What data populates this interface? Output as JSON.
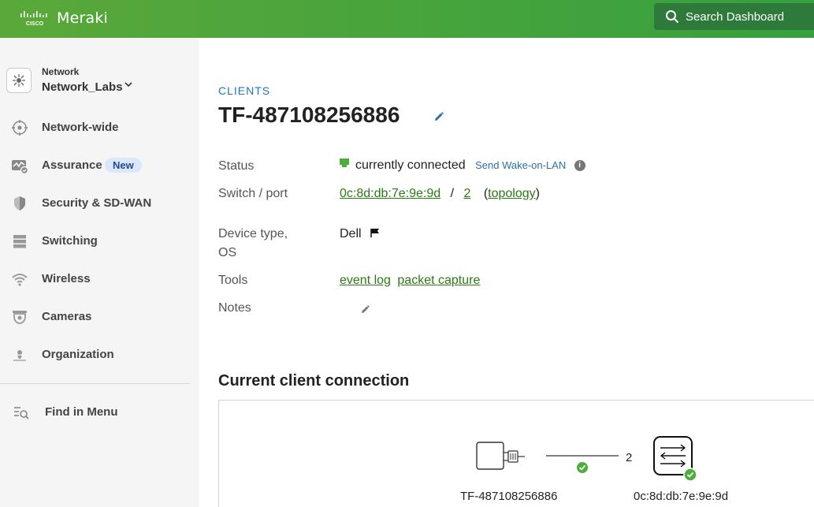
{
  "header": {
    "logo_text": "CISCO",
    "app_name": "Meraki",
    "search_label": "Search Dashboard",
    "search_icon": "search-icon",
    "brand_color": "#4caf3a"
  },
  "sidebar": {
    "network_label": "Network",
    "network_name": "Network_Labs",
    "items": [
      {
        "label": "Network-wide",
        "icon": "network-wide-icon"
      },
      {
        "label": "Assurance",
        "icon": "assurance-icon",
        "badge": "New"
      },
      {
        "label": "Security & SD-WAN",
        "icon": "shield-icon"
      },
      {
        "label": "Switching",
        "icon": "switch-icon"
      },
      {
        "label": "Wireless",
        "icon": "wifi-icon"
      },
      {
        "label": "Cameras",
        "icon": "camera-icon"
      },
      {
        "label": "Organization",
        "icon": "organization-icon"
      }
    ],
    "find_in_menu": "Find in Menu"
  },
  "main": {
    "breadcrumb": "CLIENTS",
    "title": "TF-487108256886",
    "status_label": "Status",
    "status_value": "currently connected",
    "status_color": "#4caf3a",
    "wake_on_lan": "Send Wake-on-LAN",
    "switch_port_label": "Switch / port",
    "switch_mac": "0c:8d:db:7e:9e:9d",
    "port_sep": "/",
    "port": "2",
    "topology": "topology",
    "device_type_label_1": "Device type,",
    "device_type_label_2": "OS",
    "device_type_value": "Dell",
    "tools_label": "Tools",
    "tool_event_log": "event log",
    "tool_packet_capture": "packet capture",
    "notes_label": "Notes",
    "section_title": "Current client connection",
    "client_name": "TF-487108256886",
    "link_port": "2",
    "switch_name": "0c:8d:db:7e:9e:9d"
  }
}
